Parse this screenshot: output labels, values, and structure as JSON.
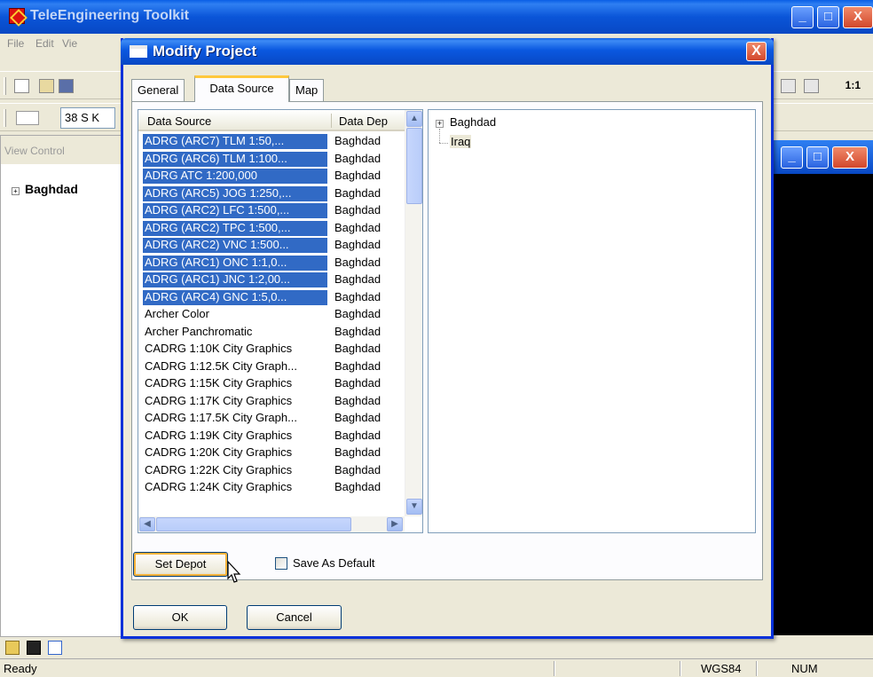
{
  "main_window": {
    "title": "TeleEngineering Toolkit",
    "menu": [
      "File",
      "Edit",
      "Vie"
    ],
    "coord_field": "38 S K",
    "zoom_label": "1:1",
    "view_control_label": "View Control",
    "tree_root": "Baghdad",
    "controls": {
      "minimize": "_",
      "maximize": "□",
      "close": "X"
    }
  },
  "dialog": {
    "title": "Modify Project",
    "close_glyph": "X",
    "tabs": [
      "General",
      "Data Source",
      "Map"
    ],
    "active_tab": "Data Source",
    "list": {
      "columns": [
        "Data Source",
        "Data Dep"
      ],
      "rows": [
        {
          "name": "ADRG (ARC7) TLM   1:50,...",
          "depot": "Baghdad",
          "selected": true
        },
        {
          "name": "ADRG (ARC6) TLM   1:100...",
          "depot": "Baghdad",
          "selected": true
        },
        {
          "name": "ADRG        ATC  1:200,000",
          "depot": "Baghdad",
          "selected": true
        },
        {
          "name": "ADRG (ARC5) JOG   1:250,...",
          "depot": "Baghdad",
          "selected": true
        },
        {
          "name": "ADRG (ARC2) LFC   1:500,...",
          "depot": "Baghdad",
          "selected": true
        },
        {
          "name": "ADRG (ARC2) TPC   1:500,...",
          "depot": "Baghdad",
          "selected": true
        },
        {
          "name": "ADRG (ARC2) VNC   1:500...",
          "depot": "Baghdad",
          "selected": true
        },
        {
          "name": "ADRG (ARC1) ONC   1:1,0...",
          "depot": "Baghdad",
          "selected": true
        },
        {
          "name": "ADRG (ARC1) JNC   1:2,00...",
          "depot": "Baghdad",
          "selected": true
        },
        {
          "name": "ADRG (ARC4) GNC   1:5,0...",
          "depot": "Baghdad",
          "selected": true
        },
        {
          "name": "Archer Color",
          "depot": "Baghdad",
          "selected": false
        },
        {
          "name": "Archer Panchromatic",
          "depot": "Baghdad",
          "selected": false
        },
        {
          "name": "CADRG 1:10K   City Graphics",
          "depot": "Baghdad",
          "selected": false
        },
        {
          "name": "CADRG 1:12.5K City Graph...",
          "depot": "Baghdad",
          "selected": false
        },
        {
          "name": "CADRG 1:15K   City Graphics",
          "depot": "Baghdad",
          "selected": false
        },
        {
          "name": "CADRG 1:17K   City Graphics",
          "depot": "Baghdad",
          "selected": false
        },
        {
          "name": "CADRG 1:17.5K City Graph...",
          "depot": "Baghdad",
          "selected": false
        },
        {
          "name": "CADRG 1:19K   City Graphics",
          "depot": "Baghdad",
          "selected": false
        },
        {
          "name": "CADRG 1:20K   City Graphics",
          "depot": "Baghdad",
          "selected": false
        },
        {
          "name": "CADRG 1:22K   City Graphics",
          "depot": "Baghdad",
          "selected": false
        },
        {
          "name": "CADRG 1:24K   City Graphics",
          "depot": "Baghdad",
          "selected": false
        }
      ]
    },
    "tree": {
      "root": "Baghdad",
      "expander": "+",
      "child": "Iraq"
    },
    "set_depot_label": "Set Depot",
    "save_default_label": "Save As Default",
    "save_default_checked": false,
    "ok_label": "OK",
    "cancel_label": "Cancel"
  },
  "status_bar": {
    "status": "Ready",
    "datum": "WGS84",
    "num": "NUM"
  },
  "colors": {
    "selection": "#316ac5",
    "title_blue": "#0a58e0",
    "dialog_face": "#ece9d8"
  }
}
